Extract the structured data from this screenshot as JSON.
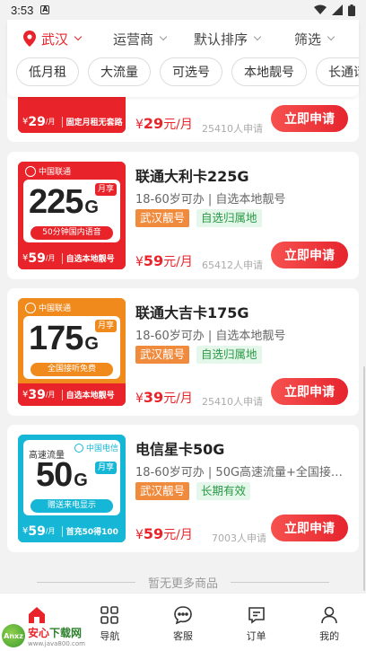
{
  "status_bar": {
    "time": "3:53",
    "notification_glyph": "A"
  },
  "filter": {
    "location": "武汉",
    "operator": "运营商",
    "sort": "默认排序",
    "filter": "筛选",
    "tags": [
      "低月租",
      "大流量",
      "可选号",
      "本地靓号",
      "长通话"
    ]
  },
  "cards": [
    {
      "thumb_price": "29",
      "thumb_unit": "/月",
      "thumb_bottom_text": "固定月租无套路",
      "price": "29",
      "price_unit": "元/月",
      "applicants": "25410人申请",
      "button": "立即申请"
    },
    {
      "brand": "中国联通",
      "big_number": "225",
      "big_unit": "G",
      "month_badge": "月享",
      "ribbon": "50分钟国内语音",
      "thumb_price": "59",
      "thumb_unit": "/月",
      "thumb_bottom_text": "自选本地靓号",
      "title": "联通大利卡225G",
      "desc": "18-60岁可办 | 自选本地靓号",
      "badges": [
        "武汉靓号",
        "自选归属地"
      ],
      "price": "59",
      "price_unit": "元/月",
      "applicants": "65412人申请",
      "button": "立即申请",
      "accent": "#e8242a"
    },
    {
      "brand": "中国联通",
      "big_number": "175",
      "big_unit": "G",
      "month_badge": "月享",
      "ribbon": "全国接听免费",
      "thumb_price": "39",
      "thumb_unit": "/月",
      "thumb_bottom_text": "自选本地靓号",
      "title": "联通大吉卡175G",
      "desc": "18-60岁可办 | 自选本地靓号",
      "badges": [
        "武汉靓号",
        "自选归属地"
      ],
      "price": "39",
      "price_unit": "元/月",
      "applicants": "25410人申请",
      "button": "立即申请",
      "accent": "#f08a1c"
    },
    {
      "brand": "中国电信",
      "label_top": "高速流量",
      "big_number": "50",
      "big_unit": "G",
      "month_badge": "月享",
      "ribbon": "赠送来电显示",
      "thumb_price": "59",
      "thumb_unit": "/月",
      "thumb_bottom_text": "首充50得100",
      "title": "电信星卡50G",
      "desc": "18-60岁可办 | 50G高速流量+全国接…",
      "badges": [
        "武汉靓号",
        "长期有效"
      ],
      "price": "59",
      "price_unit": "元/月",
      "applicants": "7003人申请",
      "button": "立即申请",
      "accent": "#16b6d6"
    }
  ],
  "currency": "¥",
  "no_more": "暂无更多商品",
  "tabs": [
    {
      "label": "首页",
      "icon": "home-icon"
    },
    {
      "label": "导航",
      "icon": "grid-icon"
    },
    {
      "label": "客服",
      "icon": "chat-icon"
    },
    {
      "label": "订单",
      "icon": "order-icon"
    },
    {
      "label": "我的",
      "icon": "user-icon"
    }
  ],
  "watermark": {
    "brand_a": "安心",
    "brand_b": "下载网",
    "url": "www.java800.com",
    "logo_text": "Anxz"
  },
  "colors": {
    "accent_red": "#e8242a",
    "badge_orange": "#f08a3c",
    "badge_green_text": "#2a9a46"
  }
}
